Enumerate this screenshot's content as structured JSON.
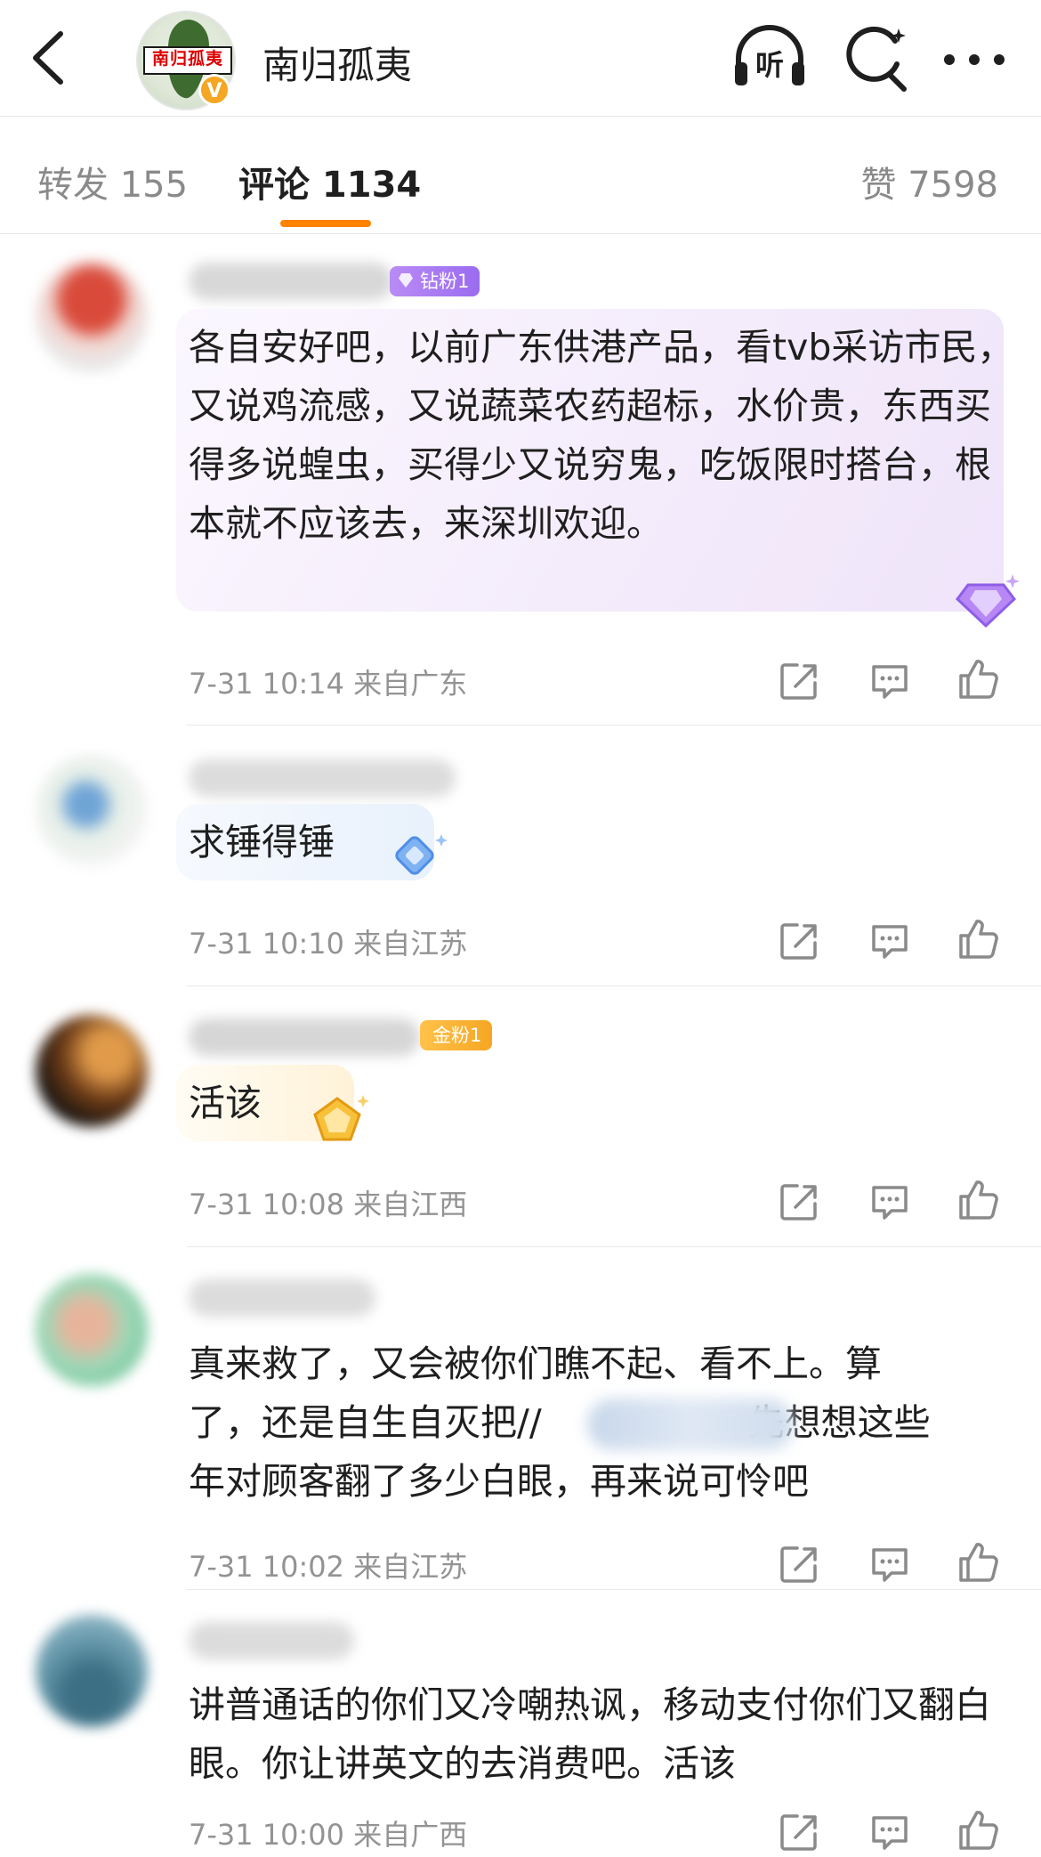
{
  "header": {
    "back_icon": "chevron-left-icon",
    "account_name": "南归孤夷",
    "avatar_stamp": "南归孤夷",
    "verified_badge": "V",
    "actions": [
      "listen-icon",
      "search-icon",
      "more-icon"
    ],
    "listen_label": "听"
  },
  "tabs": [
    {
      "label": "转发 155",
      "active": false
    },
    {
      "label": "评论 1134",
      "active": true
    },
    {
      "label": "赞 7598",
      "active": false
    }
  ],
  "accent_color": "#ff8200",
  "comments": [
    {
      "fan_badge": "钻粉1",
      "text": "各自安好吧，以前广东供港产品，看tvb采访市民，又说鸡流感，又说蔬菜农药超标，水价贵，东西买得多说蝗虫，买得少又说穷鬼，吃饭限时搭台，根本就不应该去，来深圳欢迎。",
      "time": "7-31 10:14",
      "location": "来自广东"
    },
    {
      "fan_badge": "",
      "text": "求锤得锤",
      "time": "7-31 10:10",
      "location": "来自江苏"
    },
    {
      "fan_badge": "金粉1",
      "text": "活该",
      "time": "7-31 10:08",
      "location": "来自江西"
    },
    {
      "fan_badge": "",
      "text_line1": "真来救了，又会被你们瞧不起、看不上。算",
      "text_line2_a": "了，还是自生自灭把//",
      "text_line2_b": "先想想这些",
      "text_line3": "年对顾客翻了多少白眼，再来说可怜吧",
      "time": "7-31 10:02",
      "location": "来自江苏"
    },
    {
      "fan_badge": "",
      "text": "讲普通话的你们又冷嘲热讽，移动支付你们又翻白眼。你让讲英文的去消费吧。活该",
      "time": "7-31 10:00",
      "location": "来自广西"
    }
  ],
  "comment_actions": [
    "share-icon",
    "reply-icon",
    "like-icon"
  ]
}
